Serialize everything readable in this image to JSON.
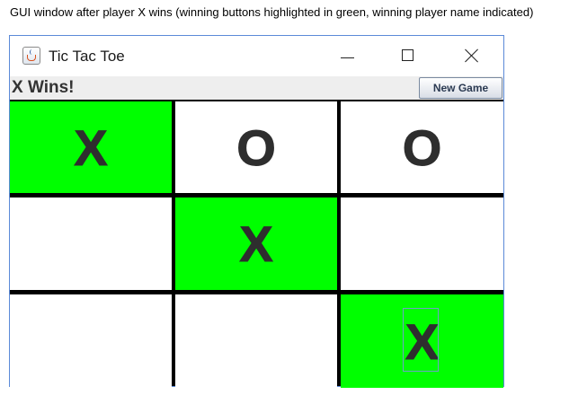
{
  "caption": "GUI window after player X wins (winning buttons highlighted in green, winning player name indicated)",
  "window": {
    "title": "Tic Tac Toe",
    "icon": "java-coffee-cup-icon",
    "controls": {
      "minimize": "minimize-icon",
      "maximize": "maximize-icon",
      "close": "close-icon"
    }
  },
  "status": {
    "message": "X Wins!",
    "new_game_label": "New Game"
  },
  "colors": {
    "win_highlight": "#00ff00",
    "cell_background": "#ffffff",
    "grid_lines": "#000000",
    "mark": "#2e2e2e"
  },
  "board": {
    "cells": [
      {
        "mark": "X",
        "winning": true
      },
      {
        "mark": "O",
        "winning": false
      },
      {
        "mark": "O",
        "winning": false
      },
      {
        "mark": "",
        "winning": false
      },
      {
        "mark": "X",
        "winning": true
      },
      {
        "mark": "",
        "winning": false
      },
      {
        "mark": "",
        "winning": false
      },
      {
        "mark": "",
        "winning": false
      },
      {
        "mark": "X",
        "winning": true,
        "focused": true
      }
    ]
  }
}
